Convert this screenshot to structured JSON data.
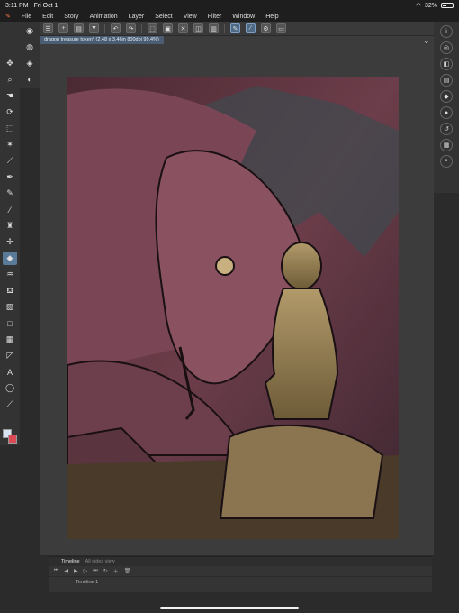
{
  "status": {
    "time": "3:11 PM",
    "date": "Fri Oct 1",
    "battery": "32%"
  },
  "menu": [
    "File",
    "Edit",
    "Story",
    "Animation",
    "Layer",
    "Select",
    "View",
    "Filter",
    "Window",
    "Help"
  ],
  "document": {
    "tab_title": "dragon treasure token* (2.48 x 3.46in 800dpi 99.4%)"
  },
  "toolbar_icons": [
    "menu-icon",
    "new-icon",
    "open-icon",
    "save-icon",
    "undo-icon",
    "redo-icon",
    "transform-icon",
    "pen-active-icon",
    "fill-icon",
    "settings-icon"
  ],
  "left_tools": [
    "move-icon",
    "zoom-icon",
    "hand-icon",
    "rotate-icon",
    "select-icon",
    "lasso-icon",
    "eyedropper-icon",
    "pen-icon",
    "pencil-icon",
    "brush-icon",
    "airbrush-icon",
    "decoration-icon",
    "eraser-icon",
    "blend-icon",
    "fill-icon",
    "gradient-icon",
    "figure-icon",
    "frame-icon",
    "ruler-icon",
    "text-icon",
    "balloon-icon",
    "correction-icon"
  ],
  "right_tools": [
    "info-icon",
    "navigator-icon",
    "layers-icon",
    "properties-icon",
    "subtool-icon",
    "color-icon",
    "history-icon",
    "material-icon",
    "search-icon"
  ],
  "timeline": {
    "tab_active": "Timeline",
    "tab_inactive": "All sides view",
    "track_label": "Timeline 1"
  },
  "colors": {
    "main": "#d8e4f2",
    "sub": "#d94a55",
    "accent": "#4a5d73"
  }
}
